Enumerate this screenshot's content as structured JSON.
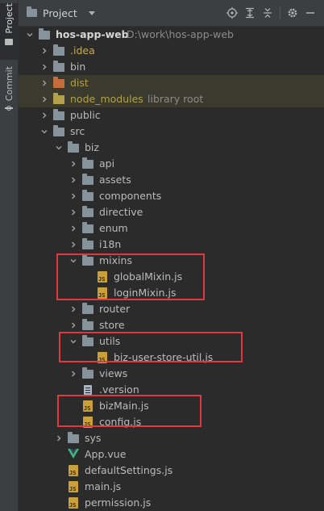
{
  "tool_strip": {
    "project_label": "Project",
    "commit_label": "Commit"
  },
  "header": {
    "title": "Project",
    "icons": [
      "locate-icon",
      "expand-all-icon",
      "collapse-all-icon",
      "settings-icon",
      "hide-icon"
    ]
  },
  "tree": {
    "root_name": "hos-app-web",
    "root_path": "D:\\work\\hos-app-web",
    "nodes_suffix": "library root",
    "items": [
      {
        "label": "hos-app-web",
        "type": "root"
      },
      {
        "label": ".idea",
        "type": "folder"
      },
      {
        "label": "bin",
        "type": "folder"
      },
      {
        "label": "dist",
        "type": "folder"
      },
      {
        "label": "node_modules",
        "type": "folder"
      },
      {
        "label": "public",
        "type": "folder"
      },
      {
        "label": "src",
        "type": "folder"
      },
      {
        "label": "biz",
        "type": "folder"
      },
      {
        "label": "api",
        "type": "folder"
      },
      {
        "label": "assets",
        "type": "folder"
      },
      {
        "label": "components",
        "type": "folder"
      },
      {
        "label": "directive",
        "type": "folder"
      },
      {
        "label": "enum",
        "type": "folder"
      },
      {
        "label": "i18n",
        "type": "folder"
      },
      {
        "label": "mixins",
        "type": "folder"
      },
      {
        "label": "globalMixin.js",
        "type": "js"
      },
      {
        "label": "loginMixin.js",
        "type": "js"
      },
      {
        "label": "router",
        "type": "folder"
      },
      {
        "label": "store",
        "type": "folder"
      },
      {
        "label": "utils",
        "type": "folder"
      },
      {
        "label": "biz-user-store-util.js",
        "type": "js"
      },
      {
        "label": "views",
        "type": "folder"
      },
      {
        "label": ".version",
        "type": "file"
      },
      {
        "label": "bizMain.js",
        "type": "js"
      },
      {
        "label": "config.js",
        "type": "js"
      },
      {
        "label": "sys",
        "type": "folder"
      },
      {
        "label": "App.vue",
        "type": "vue"
      },
      {
        "label": "defaultSettings.js",
        "type": "js"
      },
      {
        "label": "main.js",
        "type": "js"
      },
      {
        "label": "permission.js",
        "type": "js"
      }
    ]
  },
  "colors": {
    "highlight": "#e0383e",
    "background": "#2b2b2b",
    "folder": "#87939a",
    "excluded_folder": "#c36e3c",
    "excluded_text": "#b3a04a"
  }
}
